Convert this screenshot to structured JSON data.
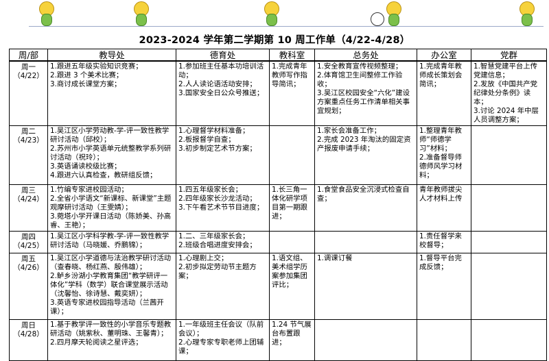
{
  "title": "2023-2024 学年第二学期第 10 周工作单（4/22-4/28）",
  "columns": [
    "周/部",
    "教导处",
    "德育处",
    "教科室",
    "总务处",
    "办公室",
    "党群"
  ],
  "rows": [
    {
      "day": "周一",
      "date": "（4/22）",
      "cells": [
        [
          "1.跟进五年级实验知识竞赛；",
          "2.跟进 3 个美术比赛；",
          "3.商讨成长课堂方案；"
        ],
        [
          "1.参加班主任基本功培训活动；",
          "2.人人读论语活动安排；",
          "3.国家安全日公众号推送；"
        ],
        [
          "1.完成青年教师写作指导简讯；"
        ],
        [
          "1.安全教育宣传视频整理；",
          "2.体育馆卫生间整修工作验收；",
          "3.吴江区校园安全“六化”建设方案重点任务工作清单相关事宜规划；"
        ],
        [
          "1.完成青年教师成长策划会简讯；"
        ],
        [
          "1.智慧党建平台上传党建信息；",
          "2.发放《中国共产党纪律处分条例》读本；",
          "3.讨论 2024 年中层人员调整方案；"
        ]
      ]
    },
    {
      "day": "周二",
      "date": "（4/23）",
      "cells": [
        [
          "1.吴江区小学劳动教-学-评一致性教学研讨活动（邱校）；",
          "2.苏州市小学英语单元统整教学系列研讨活动（祝玲）；",
          "3.英语诵读校级比赛；",
          "4.跟进六认真检查，教研组反馈；"
        ],
        [
          "1.心理督学材料准备；",
          "2.板报督学自查；",
          "3.初步制定艺术节方案；"
        ],
        [],
        [
          "1.家长会准备工作；",
          "2.完成 2023 年淘汰的固定资产报废申请手续；"
        ],
        [
          "1.整理青年教师“师德学习”材料；",
          "2.准备督导师德师风学习材料；"
        ],
        []
      ]
    },
    {
      "day": "周三",
      "date": "（4/24）",
      "cells": [
        [
          "1.竹编专家进校园活动；",
          "2.全省小学语文“新课标、新课堂”主题观摩研讨活动（王雯婧）；",
          "3.菀塔小学开课日活动（陈娇美、孙高睿、王艳）；"
        ],
        [
          "1.四五年级家长会；",
          "2.四年级家长沙龙活动；",
          "3.下午看艺术节节目进度；"
        ],
        [
          "1.长三角一体化研学项目第一期跟进；"
        ],
        [
          "1.食堂食品安全沉浸式检查自查；"
        ],
        [
          "青年教师拔尖人才材料上传"
        ],
        []
      ]
    },
    {
      "day": "周四",
      "date": "（4/25）",
      "cells": [
        [
          "1.吴江区小学科学教-学-评一致性教学研讨活动（马晓媛、乔鹏锦）；"
        ],
        [
          "1.二、三年级家长会；",
          "2.班级合唱进度安排会；"
        ],
        [],
        [],
        [
          "1.责任督学来校督导；"
        ],
        []
      ]
    },
    {
      "day": "周五",
      "date": "（4/26）",
      "cells": [
        [
          "1.吴江区小学道德与法治教学研讨活动（查春晓、杨红燕、殷伟雄）；",
          "2.鲈乡汾湖小学教育集团“教学研评一体化”学科（数学）联合课堂展示活动（沈馨怡、徐诗慧、戴奕妍）；",
          "3.英语专家进校园指导活动（兰茜开课）；"
        ],
        [
          "1.心理剧上交；",
          "2.初步拟定劳动节主题方案；"
        ],
        [
          "1.语文组、美术组学历案参加集团评比；"
        ],
        [
          "1.调课订餐"
        ],
        [
          "1.督导平台完成反馈；"
        ],
        []
      ]
    },
    {
      "day": "周日",
      "date": "（4/28）",
      "cells": [
        [
          "1.基于教学评一致性的小学音乐专题教研活动（姚紫秋、董明珠、王馨青）；",
          "2.四月摩天轮阅读之星评选；"
        ],
        [
          "1.一年级班主任会议（队前会议）；",
          "2.心理专家专职老师上团辅课；"
        ],
        [
          "1.24 节气展台布置跟进；"
        ],
        [],
        [],
        []
      ]
    }
  ]
}
